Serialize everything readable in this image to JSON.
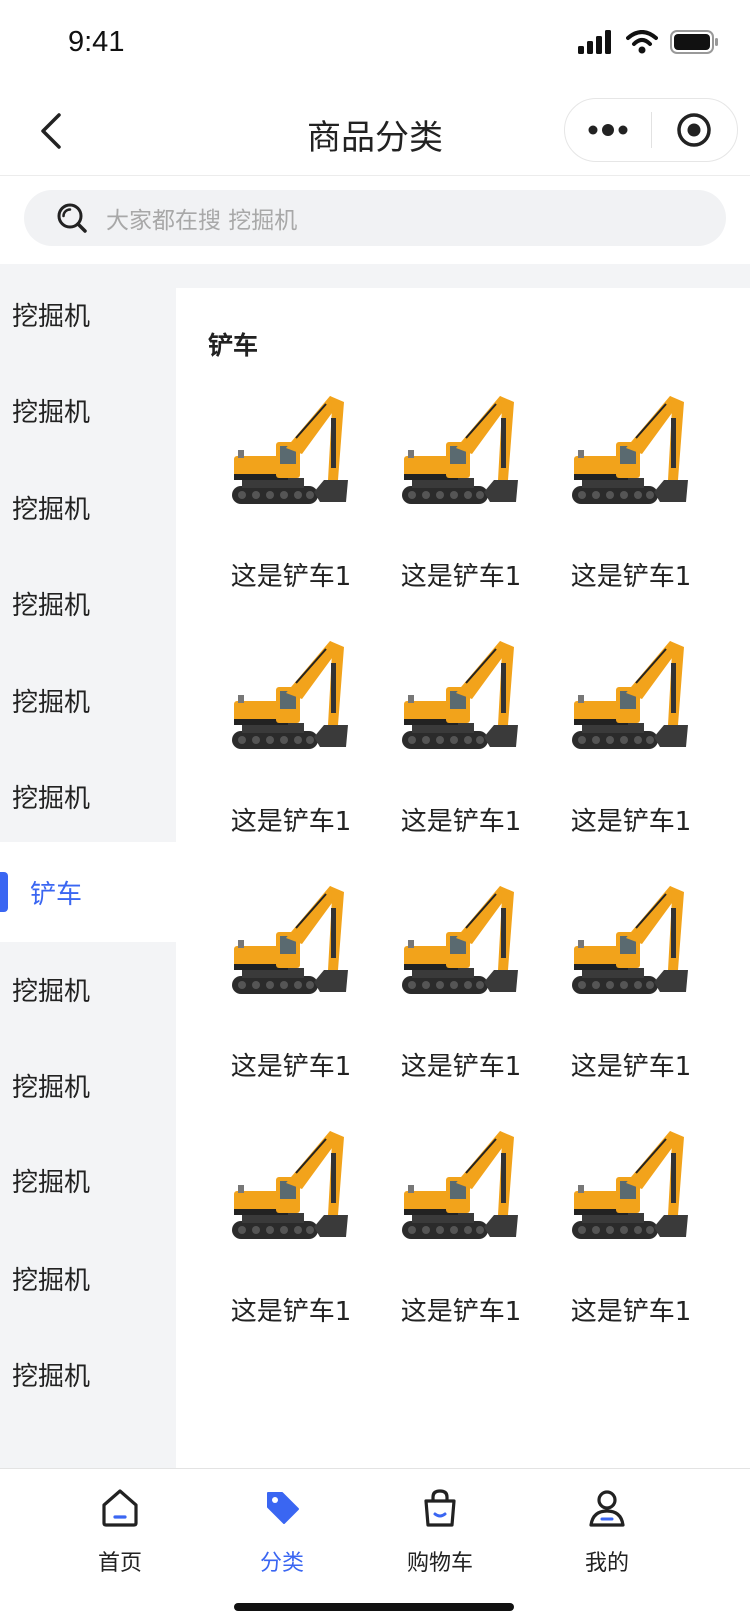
{
  "status": {
    "time": "9:41"
  },
  "nav": {
    "title": "商品分类"
  },
  "search": {
    "placeholder": "大家都在搜  挖掘机"
  },
  "sidebar": {
    "items": [
      {
        "label": "挖掘机",
        "active": false
      },
      {
        "label": "挖掘机",
        "active": false
      },
      {
        "label": "挖掘机",
        "active": false
      },
      {
        "label": "挖掘机",
        "active": false
      },
      {
        "label": "挖掘机",
        "active": false
      },
      {
        "label": "挖掘机",
        "active": false
      },
      {
        "label": "铲车",
        "active": true
      },
      {
        "label": "挖掘机",
        "active": false
      },
      {
        "label": "挖掘机",
        "active": false
      },
      {
        "label": "挖掘机",
        "active": false
      },
      {
        "label": "挖掘机",
        "active": false
      },
      {
        "label": "挖掘机",
        "active": false
      }
    ]
  },
  "content": {
    "section_title": "铲车",
    "products": [
      {
        "name": "这是铲车1"
      },
      {
        "name": "这是铲车1"
      },
      {
        "name": "这是铲车1"
      },
      {
        "name": "这是铲车1"
      },
      {
        "name": "这是铲车1"
      },
      {
        "name": "这是铲车1"
      },
      {
        "name": "这是铲车1"
      },
      {
        "name": "这是铲车1"
      },
      {
        "name": "这是铲车1"
      },
      {
        "name": "这是铲车1"
      },
      {
        "name": "这是铲车1"
      },
      {
        "name": "这是铲车1"
      }
    ]
  },
  "tabbar": {
    "tabs": [
      {
        "label": "首页",
        "icon": "home-icon",
        "active": false
      },
      {
        "label": "分类",
        "icon": "tag-icon",
        "active": true
      },
      {
        "label": "购物车",
        "icon": "shopping-bag-icon",
        "active": false
      },
      {
        "label": "我的",
        "icon": "user-icon",
        "active": false
      }
    ]
  },
  "colors": {
    "accent": "#3a66f2",
    "excavator_yellow": "#f2a31b",
    "sidebar_bg": "#f3f4f6"
  }
}
